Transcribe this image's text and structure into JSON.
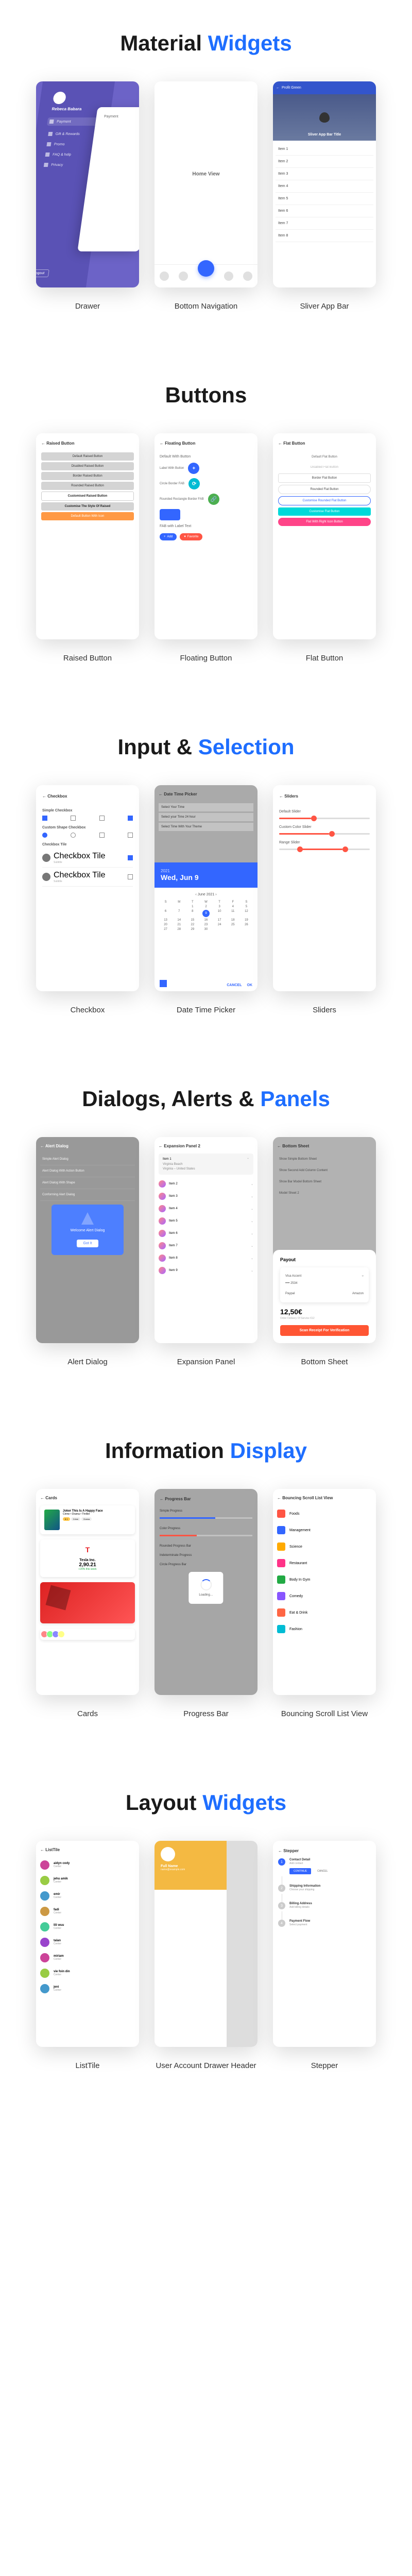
{
  "sections": {
    "material": {
      "title_a": "Material ",
      "title_b": "Widgets"
    },
    "buttons": {
      "title": "Buttons"
    },
    "input": {
      "title_a": "Input & ",
      "title_b": "Selection"
    },
    "dialogs": {
      "title_a": "Dialogs, Alerts & ",
      "title_b": "Panels"
    },
    "info": {
      "title_a": "Information ",
      "title_b": "Display"
    },
    "layout": {
      "title_a": "Layout ",
      "title_b": "Widgets"
    }
  },
  "labels": {
    "drawer": "Drawer",
    "bottom_nav": "Bottom Navigation",
    "sliver": "Sliver App Bar",
    "raised": "Raised Button",
    "floating": "Floating Button",
    "flat": "Flat Button",
    "checkbox": "Checkbox",
    "datetime": "Date Time Picker",
    "sliders": "Sliders",
    "alert": "Alert Dialog",
    "expansion": "Expansion Panel",
    "bottomsheet": "Bottom Sheet",
    "cards": "Cards",
    "progress": "Progress Bar",
    "bouncing": "Bouncing Scroll List View",
    "listtile": "ListTile",
    "user_drawer": "User Account Drawer Header",
    "stepper": "Stepper"
  },
  "drawer": {
    "user": "Rebeca Babara",
    "items": [
      "Payment",
      "Gift & Rewards",
      "Promo",
      "FAQ & help",
      "Privacy"
    ],
    "logout": "Logout",
    "card_text": "Payment"
  },
  "bottomnav": {
    "center": "Home View"
  },
  "sliver": {
    "topbar": "Profit Green",
    "title": "Sliver App Bar Title",
    "items": [
      "Item 1",
      "Item 2",
      "Item 3",
      "Item 4",
      "Item 5",
      "Item 6",
      "Item 7",
      "Item 8"
    ]
  },
  "raised": {
    "header": "Raised Button",
    "btns": [
      "Default Raised Button",
      "Disabled Raised Button",
      "Border Raised Button",
      "Rounded Raised Button",
      "Customised Raised Button",
      "Customise The Style Of Raised",
      "Default Button With Icon"
    ]
  },
  "floating": {
    "header": "Floating Button",
    "l1": "Default With Button",
    "l2": "Label With Button",
    "l3": "Circle Border FAB",
    "l4": "Rounded Rectangle Border FAB",
    "l5": "FAB with Label Text",
    "pill1": "Add",
    "pill2": "Favorite"
  },
  "flat": {
    "header": "Flat Button",
    "btns": [
      "Default Flat Button",
      "Disabled Flat Button",
      "Border Flat Button",
      "Rounded Flat Button",
      "Customise Rounded Flat Button",
      "Customise Flat Button",
      "Flat With Right Icon Button"
    ]
  },
  "checkbox": {
    "header": "Checkbox",
    "s1": "Simple Checkbox",
    "s2": "Custom Shape Checkbox",
    "s3": "Checkbox Tile",
    "tile_title": "Checkbox Tile",
    "tile_sub": "Subtitle"
  },
  "datetime": {
    "header": "Date Time Picker",
    "rows": [
      "Select Your Time",
      "Select your Time 24 hour",
      "Select Time With Your Theme"
    ],
    "year": "2021",
    "date": "Wed, Jun 9",
    "month": "June 2021",
    "days": [
      "S",
      "M",
      "T",
      "W",
      "T",
      "F",
      "S"
    ],
    "cancel": "CANCEL",
    "ok": "OK"
  },
  "sliders": {
    "header": "Sliders",
    "l1": "Default Slider",
    "l2": "Custom Color Slider",
    "l3": "Range Slider"
  },
  "alert": {
    "header": "Alert Dialog",
    "rows": [
      "Simple Alert Dialog",
      "Alert Dialog With Action Button",
      "Alert Dialog With Shape",
      "Conforming Alert Dialog"
    ],
    "message": "Welcome Alert Dialog",
    "btn": "Got It"
  },
  "expansion": {
    "header": "Expansion Panel 2",
    "open_title": "Item 1",
    "open_sub": "Virginia Beach",
    "open_location": "Virginia – United States",
    "items": [
      "Item 2",
      "Item 3",
      "Item 4",
      "Item 5",
      "Item 6",
      "Item 7",
      "Item 8",
      "Item 9"
    ]
  },
  "bottomsheet": {
    "header": "Bottom Sheet",
    "rows": [
      "Show Simple Bottom Sheet",
      "Show Second Add Column Content",
      "Show Bar Model Bottom Sheet",
      "Model Sheet 2"
    ],
    "title": "Payout",
    "methods": [
      "Visa Accent",
      "•••• 2534"
    ],
    "tabs": [
      "Paypal",
      "Amazon"
    ],
    "amount": "12,50€",
    "sub": "Order Delivery Of Service €12",
    "cta": "Scan Receipt For Verification"
  },
  "cards": {
    "header": "Cards",
    "movie_title": "Joker This Is A Happy Face",
    "movie_sub": "Crime • Drama • Thriller",
    "chips": [
      "8.1",
      "Crime",
      "Drama"
    ],
    "tesla": "Tesla Inc.",
    "tesla_price": "2,90.21",
    "tesla_change": "+20% this week"
  },
  "progress": {
    "header": "Progress Bar",
    "rows": [
      "Simple Progress",
      "Color Progress",
      "Rounded Progress Bar",
      "Indeterminate Progress",
      "Circle Progress Bar"
    ],
    "text": "Loading…"
  },
  "bounce": {
    "header": "Bouncing Scroll List View",
    "items": [
      {
        "label": "Foods",
        "color": "#ff5544"
      },
      {
        "label": "Management",
        "color": "#3366ff"
      },
      {
        "label": "Science",
        "color": "#ffaa00"
      },
      {
        "label": "Restaurant",
        "color": "#ff3388"
      },
      {
        "label": "Body In Gym",
        "color": "#22aa44"
      },
      {
        "label": "Comedy",
        "color": "#8855ff"
      },
      {
        "label": "Eat & Drink",
        "color": "#ff6644"
      },
      {
        "label": "Fashion",
        "color": "#00bcd4"
      }
    ]
  },
  "listtile": {
    "header": "ListTile",
    "items": [
      {
        "name": "aidyn cody",
        "sub": "Center",
        "color": "#c49"
      },
      {
        "name": "jehu amik",
        "sub": "Center",
        "color": "#9c4"
      },
      {
        "name": "emir",
        "sub": "Center",
        "color": "#49c"
      },
      {
        "name": "fadi",
        "sub": "Center",
        "color": "#c94"
      },
      {
        "name": "lili wuu",
        "sub": "Center",
        "color": "#4c9"
      },
      {
        "name": "talan",
        "sub": "Center",
        "color": "#94c"
      },
      {
        "name": "miriam",
        "sub": "Center",
        "color": "#c49"
      },
      {
        "name": "vie foin din",
        "sub": "Center",
        "color": "#9c4"
      },
      {
        "name": "jeni",
        "sub": "Center",
        "color": "#49c"
      }
    ]
  },
  "userdrawer": {
    "name": "Full Name",
    "email": "name@example.com"
  },
  "stepper": {
    "header": "Stepper",
    "steps": [
      {
        "title": "Contact Detail",
        "sub": "Add contact"
      },
      {
        "title": "Shipping Information",
        "sub": "Choose your shipping"
      },
      {
        "title": "Billing Address",
        "sub": "Add billing details"
      },
      {
        "title": "Payment Flow",
        "sub": "Select payment"
      }
    ],
    "continue": "CONTINUE",
    "cancel": "CANCEL"
  }
}
